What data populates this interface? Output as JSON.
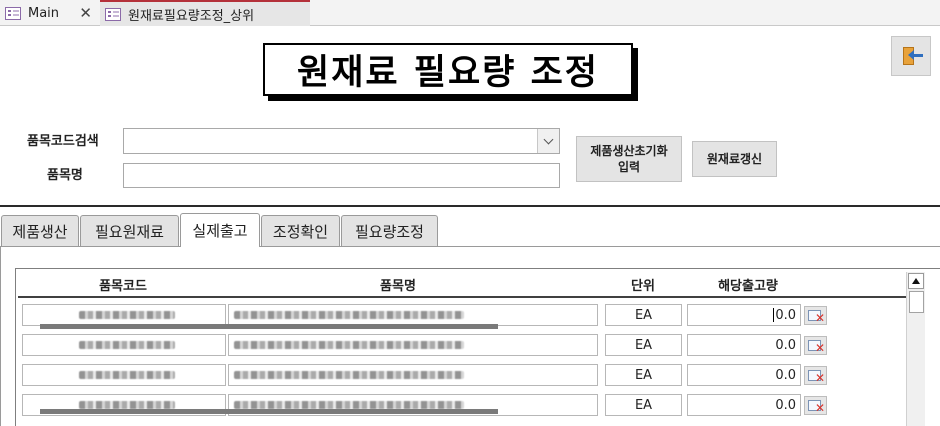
{
  "doc_tabs": [
    {
      "label": "Main",
      "active": false
    },
    {
      "label": "원재료필요량조정_상위",
      "active": true
    }
  ],
  "form": {
    "title": "원재료 필요량 조정",
    "exit_icon": "exit-door-icon"
  },
  "search": {
    "item_code_label": "품목코드검색",
    "item_code_value": "",
    "item_name_label": "품목명",
    "item_name_value": ""
  },
  "buttons": {
    "initial_input_line1": "제품생산초기화",
    "initial_input_line2": "입력",
    "refresh": "원재료갱신"
  },
  "page_tabs": [
    {
      "label": "제품생산",
      "active": false
    },
    {
      "label": "필요원재료",
      "active": false
    },
    {
      "label": "실제출고",
      "active": true
    },
    {
      "label": "조정확인",
      "active": false
    },
    {
      "label": "필요량조정",
      "active": false
    }
  ],
  "grid": {
    "columns": {
      "item_code": "품목코드",
      "item_name": "품목명",
      "unit": "단위",
      "qty": "해당출고량"
    },
    "rows": [
      {
        "item_code": "",
        "item_name": "",
        "unit": "EA",
        "qty": "0.0",
        "redacted": true
      },
      {
        "item_code": "",
        "item_name": "",
        "unit": "EA",
        "qty": "0.0",
        "redacted": true
      },
      {
        "item_code": "",
        "item_name": "",
        "unit": "EA",
        "qty": "0.0",
        "redacted": true
      },
      {
        "item_code": "",
        "item_name": "",
        "unit": "EA",
        "qty": "0.0",
        "redacted": true
      }
    ],
    "delete_icon": "delete-record-icon"
  },
  "colors": {
    "active_tab_accent": "#b4313a",
    "delete_icon": "#d8332c",
    "form_icon": "#8b6aa8"
  }
}
